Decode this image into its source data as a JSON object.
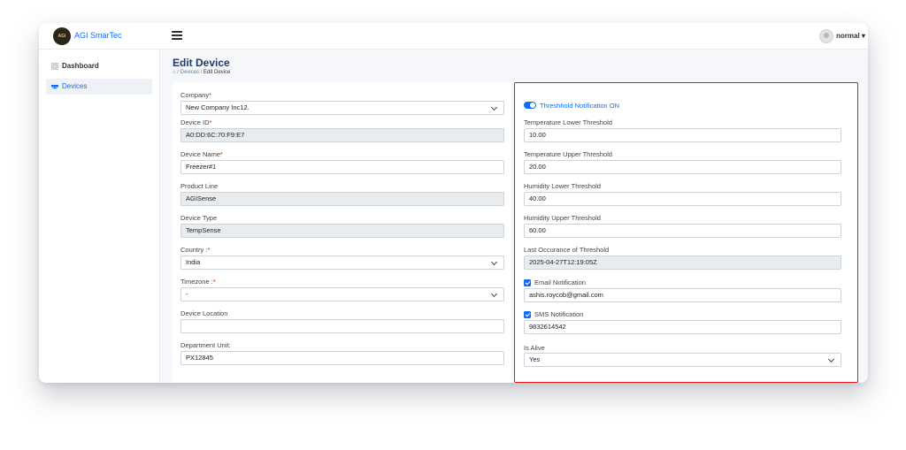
{
  "app": {
    "brand": "AGI SmarTec",
    "logo_text": "AGI"
  },
  "user": {
    "name": "normal ▾"
  },
  "sidebar": {
    "items": [
      {
        "label": "Dashboard",
        "icon": "grid-icon"
      },
      {
        "label": "Devices",
        "icon": "router-icon"
      }
    ]
  },
  "page": {
    "title": "Edit Device",
    "breadcrumb": {
      "sep1": "/",
      "devices": "Devices",
      "sep2": "/",
      "current": "Edit Device"
    }
  },
  "form_left": {
    "company": {
      "label": "Company",
      "req": "*",
      "value": "New Company Inc12."
    },
    "device_id": {
      "label": "Device ID",
      "req": "*",
      "value": "A0:DD:6C:70:F9:E7"
    },
    "device_name": {
      "label": "Device Name",
      "req": "*",
      "value": "Freezer#1"
    },
    "product_line": {
      "label": "Product Line",
      "value": "AGISense"
    },
    "device_type": {
      "label": "Device Type",
      "value": "TempSense"
    },
    "country": {
      "label": "Country :",
      "req": "*",
      "value": "India"
    },
    "timezone": {
      "label": "Timezone :",
      "req": "*",
      "value": "-"
    },
    "device_location": {
      "label": "Device Location",
      "value": ""
    },
    "department_unit": {
      "label": "Department Unit:",
      "value": "PX12845"
    }
  },
  "form_right": {
    "threshold_toggle": {
      "label": "Threshhold Notification ON",
      "on": true
    },
    "temp_lower": {
      "label": "Temperature Lower Threshold",
      "value": "10.00"
    },
    "temp_upper": {
      "label": "Temperature Upper Threshold",
      "value": "20.00"
    },
    "humidity_lower": {
      "label": "Humidity Lower Threshold",
      "value": "40.00"
    },
    "humidity_upper": {
      "label": "Humidity Upper Threshold",
      "value": "60.00"
    },
    "last_occurance": {
      "label": "Last Occurance of Threshold",
      "value": "2025-04-27T12:19:05Z"
    },
    "email_notification": {
      "label": "Email Notification",
      "checked": true,
      "value": "ashis.roycob@gmail.com"
    },
    "sms_notification": {
      "label": "SMS Notification",
      "checked": true,
      "value": "9832614542"
    },
    "is_alive": {
      "label": "Is Alive",
      "value": "Yes"
    }
  },
  "colors": {
    "primary": "#0d6efd",
    "required": "#e3141a",
    "highlight_border": "#e3141a",
    "disabled_bg": "#e9ecef",
    "page_title": "#1f3a68"
  }
}
